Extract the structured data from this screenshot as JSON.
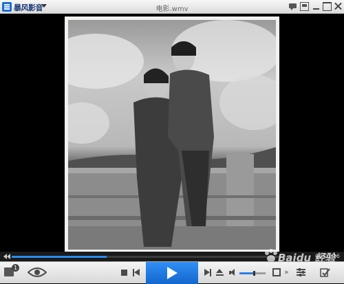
{
  "app": {
    "name": "暴风影音",
    "window_title": "电影.wmv"
  },
  "playback": {
    "time": "00:01:16",
    "progress": 0.34,
    "volume": 0.55
  },
  "playlist": {
    "badge_count": "1"
  },
  "watermark": {
    "text": "Baidu 经验"
  },
  "colors": {
    "accent": "#1a78e6",
    "title_text": "#1c3b78"
  },
  "icons": {
    "logo": "storm-logo-icon",
    "playlist": "playlist-icon",
    "eye": "eye-icon",
    "stop": "stop-icon",
    "prev": "previous-icon",
    "play": "play-icon",
    "next": "next-icon",
    "eject": "eject-icon",
    "volume": "volume-icon",
    "fullscreen": "fullscreen-icon",
    "settings": "equalizer-icon"
  }
}
